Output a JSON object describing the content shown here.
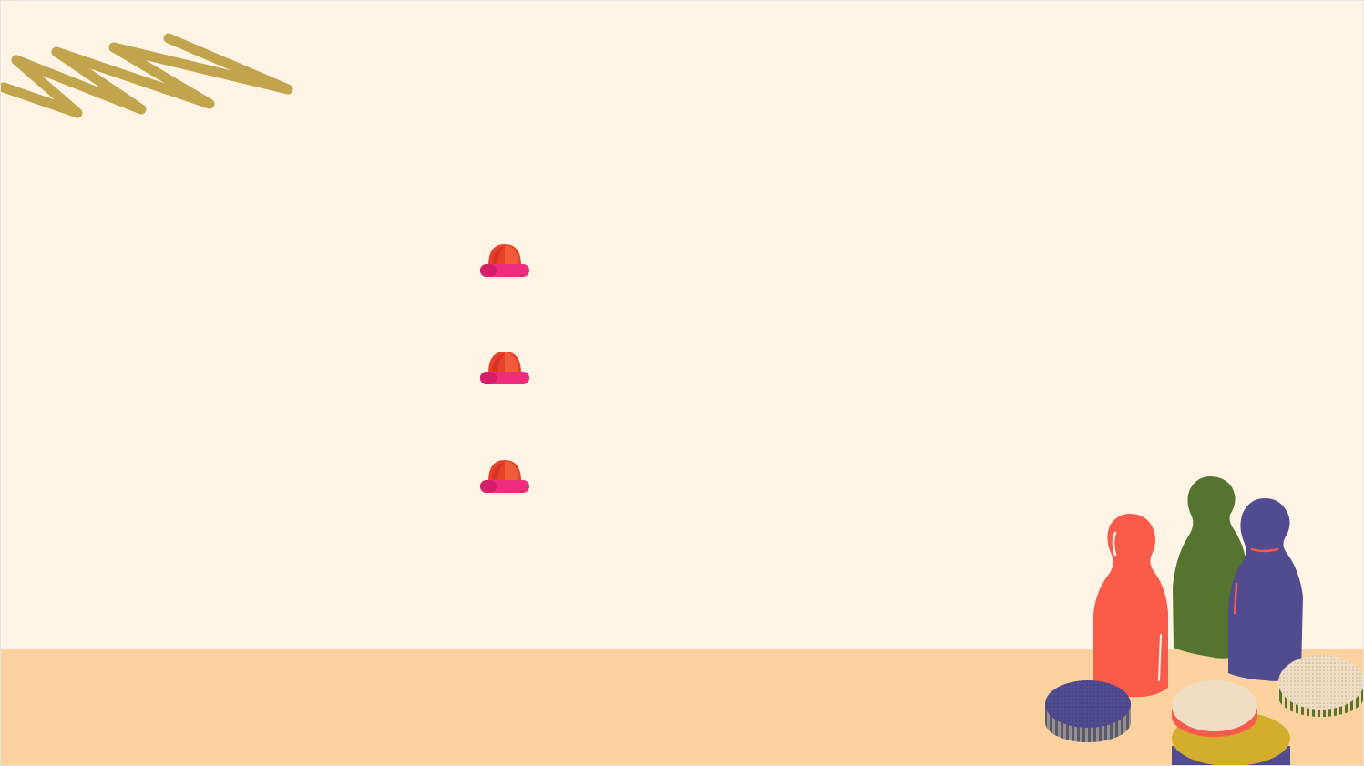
{
  "colors": {
    "background": "#fff4e5",
    "floor": "#fdd29e",
    "scribble": "#c2a44c",
    "bullet_top": "#e8412b",
    "bullet_base": "#ef2b7c",
    "pawn_red": "#fb5b4b",
    "pawn_green": "#55742f",
    "pawn_blue": "#514c8f",
    "chip_cream": "#efdec4",
    "chip_yellow": "#d5ad2d"
  },
  "bullets": [
    {
      "icon": "red-dome-bullet-icon"
    },
    {
      "icon": "red-dome-bullet-icon"
    },
    {
      "icon": "red-dome-bullet-icon"
    }
  ]
}
